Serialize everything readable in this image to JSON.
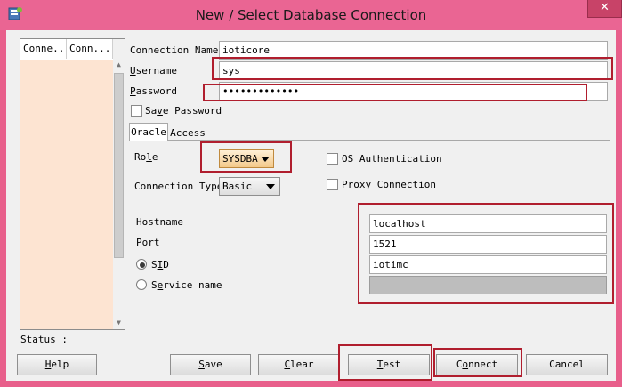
{
  "window": {
    "title": "New / Select Database Connection",
    "close_glyph": "✕"
  },
  "connections_list": {
    "columns": [
      "Conne...",
      "Conn..."
    ]
  },
  "form": {
    "connection_name_label": "Connection Name",
    "connection_name_value": "ioticore",
    "username_label_u": "U",
    "username_label_rest": "sername",
    "username_value": "sys",
    "password_label_u": "P",
    "password_label_rest": "assword",
    "password_value": "•••••••••••••",
    "save_password_pre": "Sa",
    "save_password_u": "v",
    "save_password_post": "e Password"
  },
  "tabs": {
    "oracle": "Oracle",
    "access": "Access"
  },
  "oracle": {
    "role_label_pre": "Ro",
    "role_label_u": "l",
    "role_label_post": "e",
    "role_value": "SYSDBA",
    "os_auth_label": "OS Authentication",
    "connection_type_label": "Connection Type",
    "connection_type_value": "Basic",
    "proxy_label": "Proxy Connection",
    "hostname_label": "Hostname",
    "hostname_value": "localhost",
    "port_label": "Port",
    "port_value": "1521",
    "sid_label_pre": "S",
    "sid_label_u": "I",
    "sid_label_post": "D",
    "sid_value": "iotimc",
    "service_label_pre": "S",
    "service_label_u": "e",
    "service_label_post": "rvice name"
  },
  "status": {
    "label": "Status :"
  },
  "buttons": {
    "help_u": "H",
    "help_rest": "elp",
    "save_u": "S",
    "save_rest": "ave",
    "clear_u": "C",
    "clear_rest": "lear",
    "test_u": "T",
    "test_rest": "est",
    "connect_pre": "C",
    "connect_u": "o",
    "connect_post": "nnect",
    "cancel": "Cancel"
  },
  "colors": {
    "titlebar": "#ea6593",
    "highlight": "#b01e2e",
    "list_bg": "#fde4d2"
  },
  "icons": {
    "app": "database-icon",
    "close": "close-icon"
  }
}
